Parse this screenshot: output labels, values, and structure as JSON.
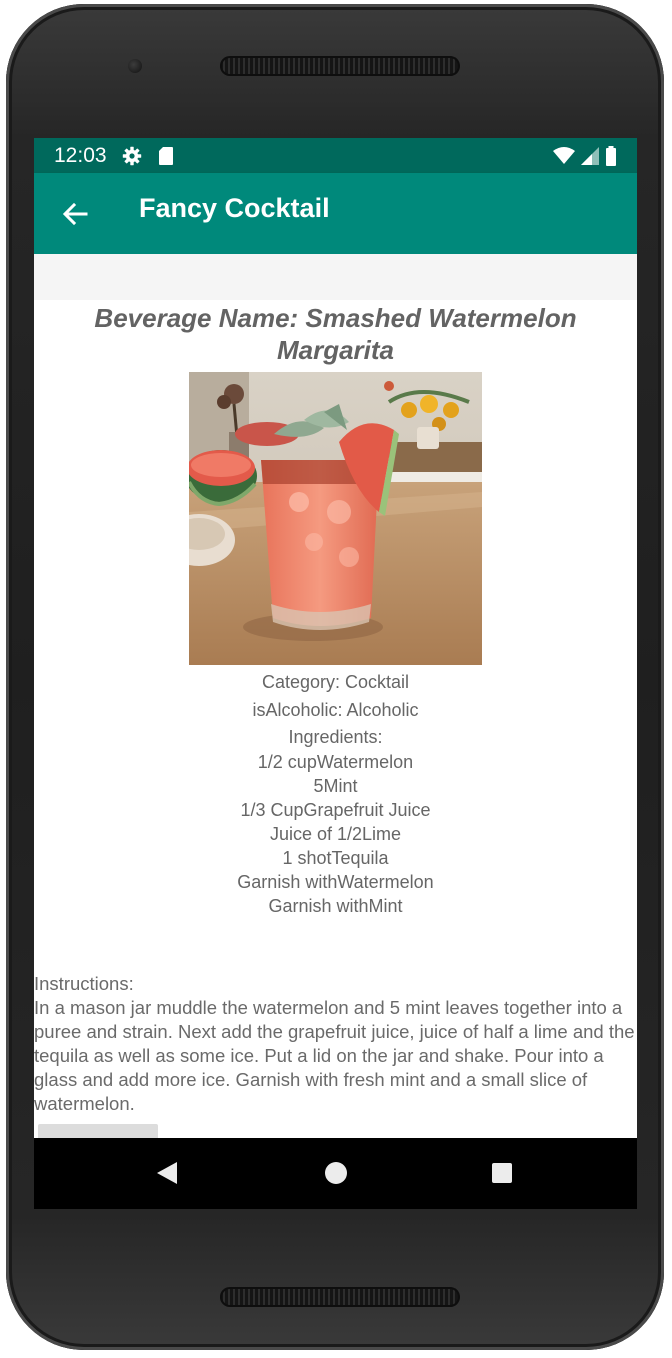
{
  "status_bar": {
    "time": "12:03",
    "icons": [
      "settings-icon",
      "sd-card-icon",
      "wifi-icon",
      "signal-icon",
      "battery-icon"
    ]
  },
  "app_bar": {
    "title": "Fancy Cocktail",
    "background": "#00897b",
    "status_background": "#00695c"
  },
  "drink": {
    "name": "Beverage Name: Smashed Watermelon Margarita",
    "category": "Category: Cocktail",
    "alcoholic": "isAlcoholic: Alcoholic",
    "ingredients_label": "Ingredients:",
    "ingredients": [
      "1/2 cupWatermelon",
      "5Mint",
      "1/3 CupGrapefruit Juice",
      "Juice of 1/2Lime",
      "1 shotTequila",
      "Garnish withWatermelon",
      "Garnish withMint"
    ],
    "instructions_label": "Instructions:",
    "instructions": "In a mason jar muddle the watermelon and 5 mint leaves together into a puree and strain. Next add the grapefruit juice, juice of half a lime and the tequila as well as some ice. Put a lid on the jar and shake. Pour into a glass and add more ice. Garnish with fresh mint and a small slice of watermelon."
  },
  "nav_bar": {
    "buttons": [
      "back-triangle-icon",
      "home-circle-icon",
      "recents-square-icon"
    ]
  }
}
